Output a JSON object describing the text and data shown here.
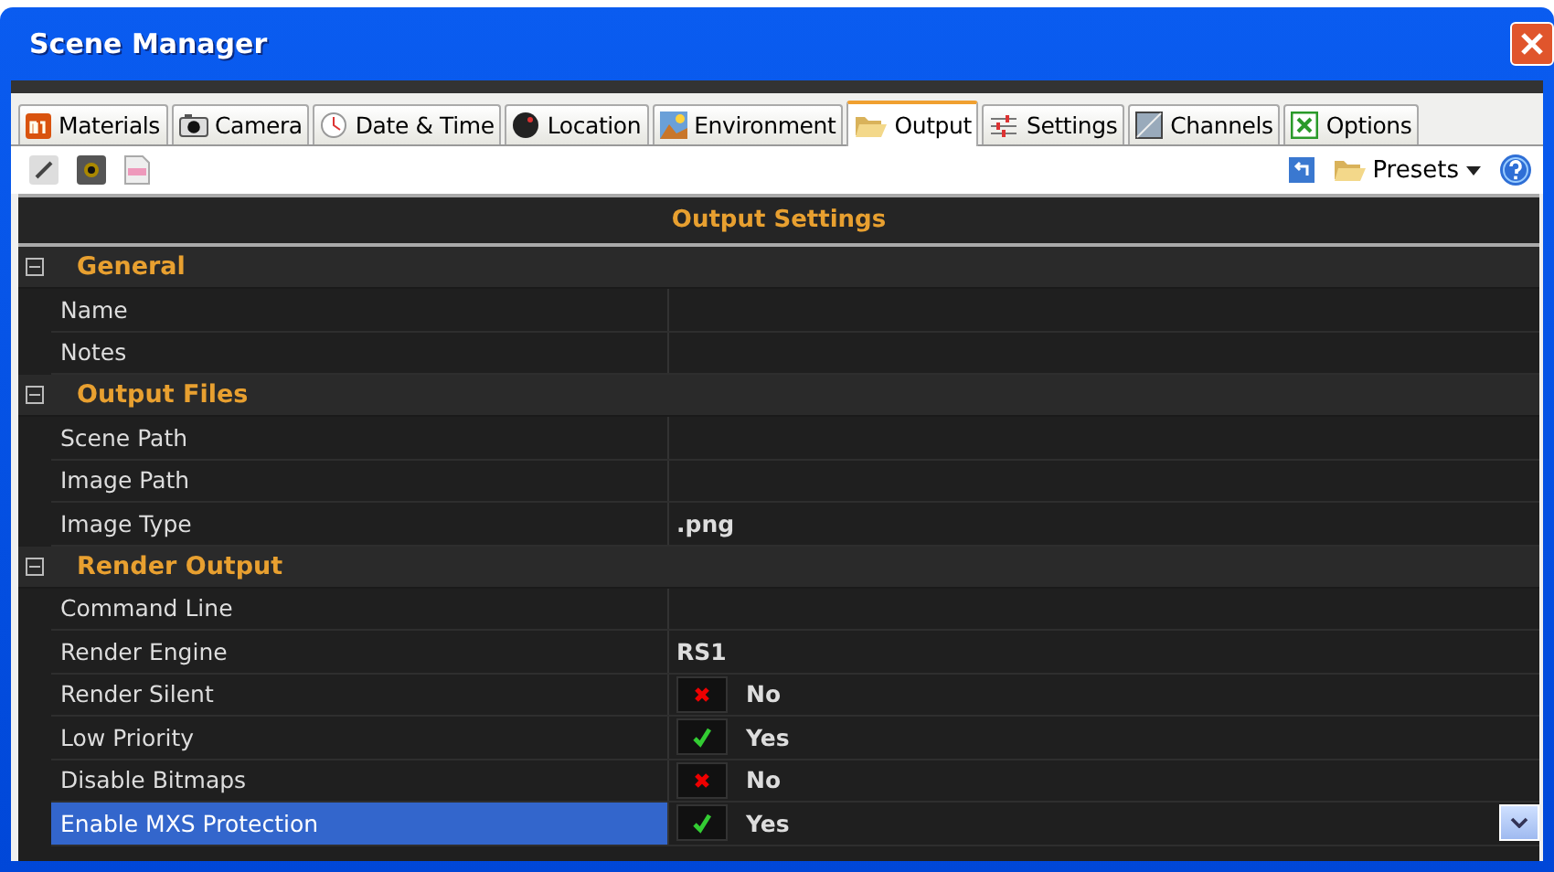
{
  "window": {
    "title": "Scene Manager"
  },
  "tabs": [
    {
      "label": "Materials",
      "selected": false
    },
    {
      "label": "Camera",
      "selected": false
    },
    {
      "label": "Date & Time",
      "selected": false
    },
    {
      "label": "Location",
      "selected": false
    },
    {
      "label": "Environment",
      "selected": false
    },
    {
      "label": "Output",
      "selected": true
    },
    {
      "label": "Settings",
      "selected": false
    },
    {
      "label": "Channels",
      "selected": false
    },
    {
      "label": "Options",
      "selected": false
    }
  ],
  "toolbar": {
    "presets": "Presets"
  },
  "grid": {
    "title": "Output Settings",
    "sections": [
      {
        "title": "General",
        "expanded": true,
        "rows": [
          {
            "label": "Name",
            "kind": "text",
            "selected": false
          },
          {
            "label": "Notes",
            "kind": "text",
            "selected": false
          }
        ]
      },
      {
        "title": "Output Files",
        "expanded": true,
        "rows": [
          {
            "label": "Scene Path",
            "kind": "text",
            "selected": false
          },
          {
            "label": "Image Path",
            "kind": "text",
            "selected": false
          },
          {
            "label": "Image Type",
            "kind": "text",
            "value": ".png",
            "selected": false
          }
        ]
      },
      {
        "title": "Render Output",
        "expanded": true,
        "rows": [
          {
            "label": "Command Line",
            "kind": "text",
            "selected": false
          },
          {
            "label": "Render Engine",
            "kind": "text",
            "value": "RS1",
            "selected": false
          },
          {
            "label": "Render Silent",
            "kind": "bool",
            "checked": false,
            "value": "No",
            "selected": false
          },
          {
            "label": "Low Priority",
            "kind": "bool",
            "checked": true,
            "value": "Yes",
            "selected": false
          },
          {
            "label": "Disable Bitmaps",
            "kind": "bool",
            "checked": false,
            "value": "No",
            "selected": false
          },
          {
            "label": "Enable MXS Protection",
            "kind": "bool",
            "checked": true,
            "value": "Yes",
            "selected": true
          }
        ]
      }
    ]
  }
}
